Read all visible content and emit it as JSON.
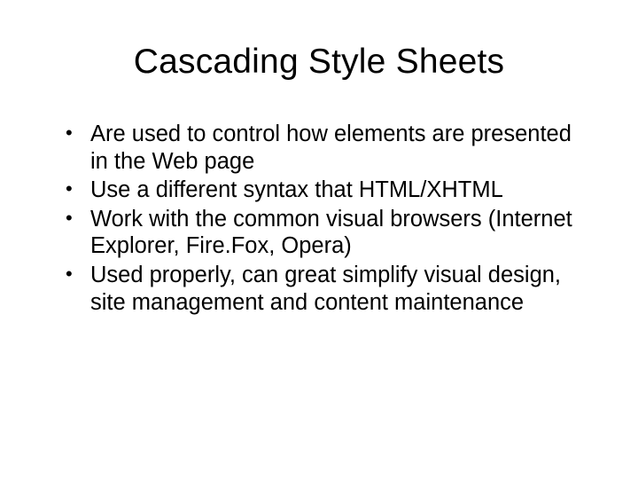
{
  "slide": {
    "title": "Cascading Style Sheets",
    "bullets": [
      "Are used to control how elements are presented in the Web page",
      "Use a different syntax that HTML/XHTML",
      "Work with the common visual browsers (Internet Explorer, Fire.Fox, Opera)",
      "Used properly, can great simplify visual design, site management and content maintenance"
    ]
  }
}
